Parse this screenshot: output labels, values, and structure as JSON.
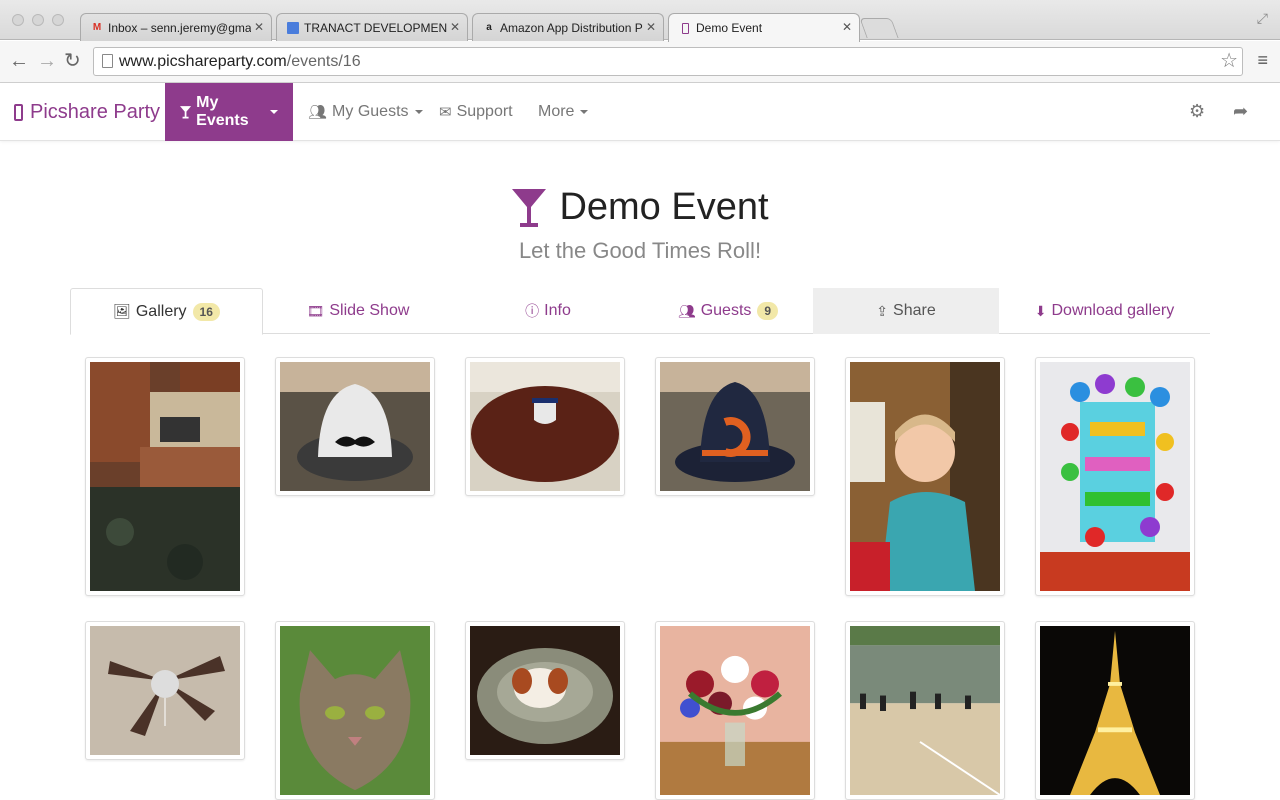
{
  "browser": {
    "tabs": [
      {
        "title": "Inbox – senn.jeremy@gma",
        "favicon": "gmail-icon",
        "active": false
      },
      {
        "title": "TRANACT DEVELOPMENT –",
        "favicon": "docs-icon",
        "active": false
      },
      {
        "title": "Amazon App Distribution P",
        "favicon": "amazon-icon",
        "active": false
      },
      {
        "title": "Demo Event",
        "favicon": "phone-icon",
        "active": true
      }
    ],
    "url_host": "www.picshareparty.com",
    "url_path": "/events/16"
  },
  "site": {
    "brand": "Picshare Party",
    "nav": {
      "my_events": "My Events",
      "my_guests": "My Guests",
      "support": "Support",
      "more": "More"
    }
  },
  "event": {
    "title": "Demo Event",
    "subtitle": "Let the Good Times Roll!"
  },
  "tabs": {
    "gallery": "Gallery",
    "gallery_count": "16",
    "slideshow": "Slide Show",
    "info": "Info",
    "guests": "Guests",
    "guests_count": "9",
    "share": "Share",
    "download": "Download gallery"
  },
  "colors": {
    "brand": "#8e3b8c",
    "badge": "#f2e8a8"
  }
}
